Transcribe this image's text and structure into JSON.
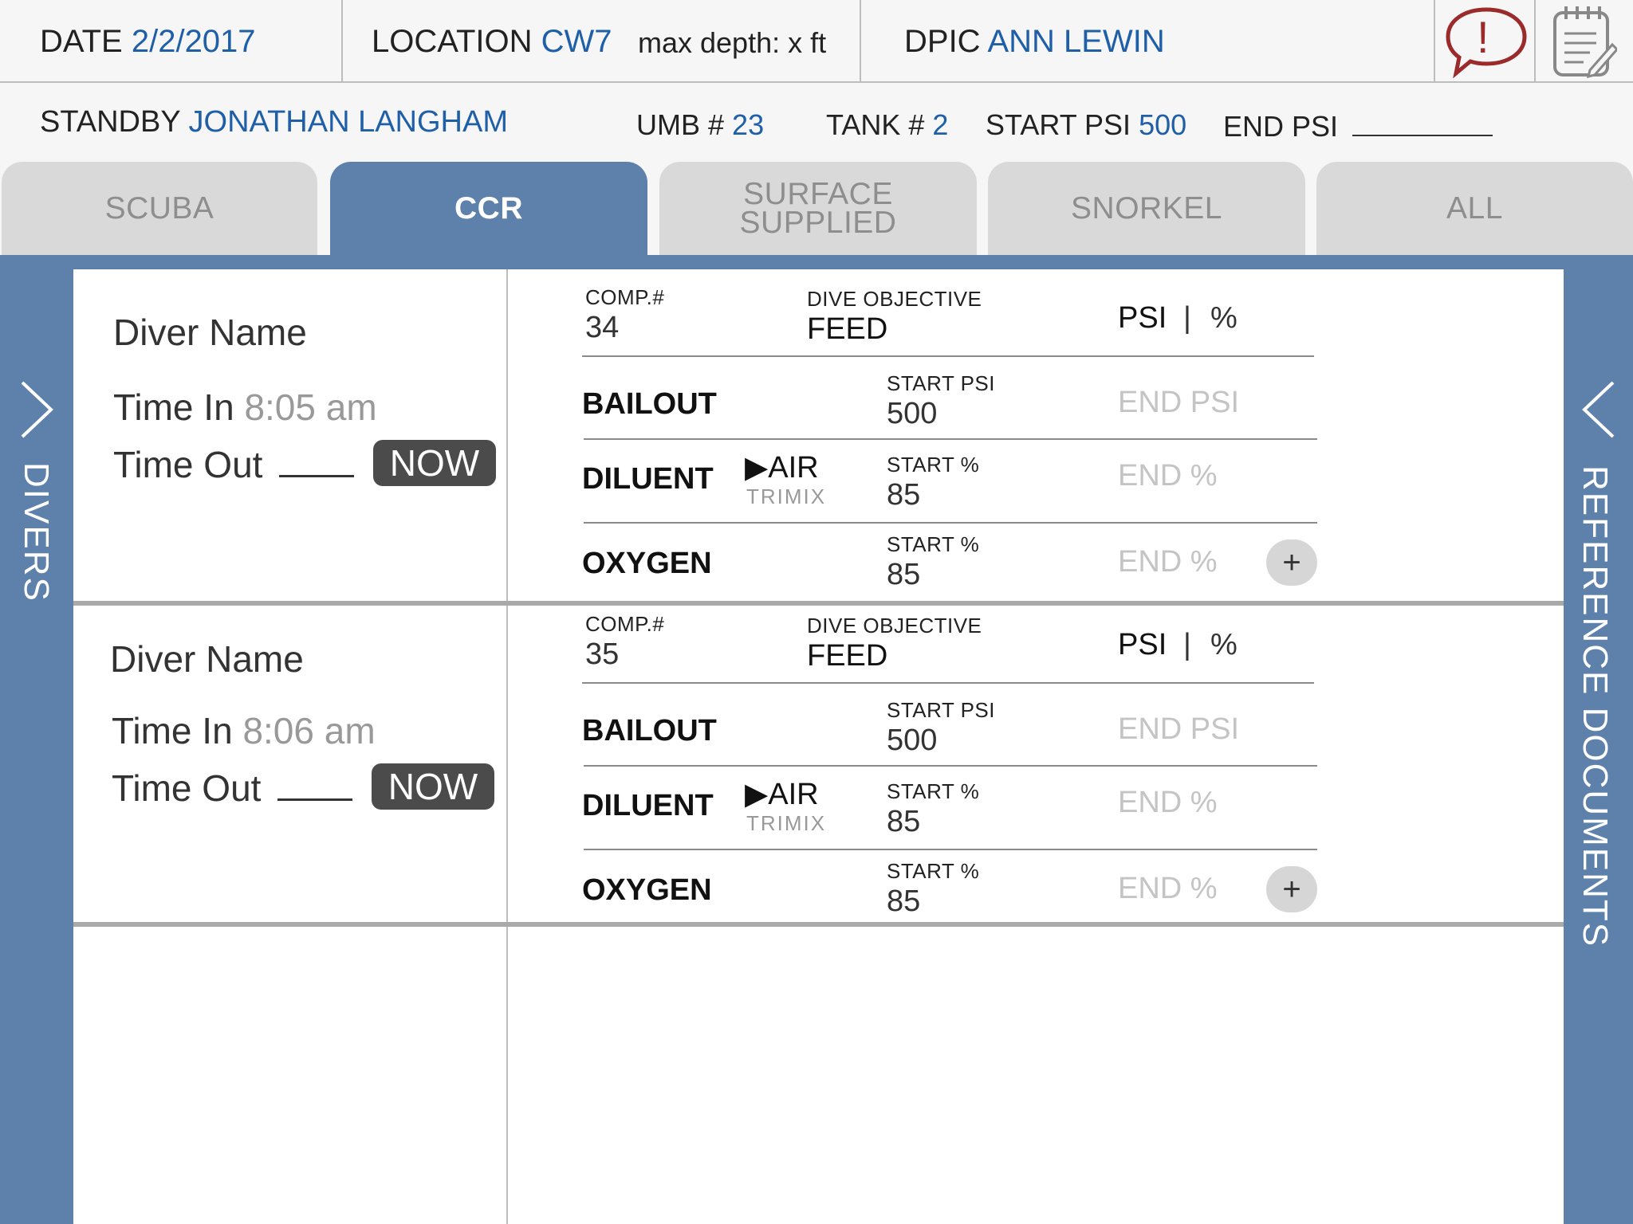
{
  "header": {
    "date_label": "DATE",
    "date_value": "2/2/2017",
    "location_label": "LOCATION",
    "location_value": "CW7",
    "max_depth": "max depth: x ft",
    "dpic_label": "DPIC",
    "dpic_value": "ANN LEWIN",
    "alert_glyph": "!",
    "icons": [
      "alert-speech-bubble-icon",
      "notepad-icon"
    ]
  },
  "subheader": {
    "standby_label": "STANDBY",
    "standby_value": "JONATHAN LANGHAM",
    "umb_label": "UMB #",
    "umb_value": "23",
    "tank_label": "TANK #",
    "tank_value": "2",
    "start_psi_label": "START PSI",
    "start_psi_value": "500",
    "end_psi_label": "END PSI"
  },
  "tabs": [
    {
      "label": "SCUBA",
      "active": false
    },
    {
      "label": "CCR",
      "active": true
    },
    {
      "label": "SURFACE SUPPLIED",
      "line1": "SURFACE",
      "line2": "SUPPLIED",
      "active": false
    },
    {
      "label": "SNORKEL",
      "active": false
    },
    {
      "label": "ALL",
      "active": false
    }
  ],
  "rails": {
    "left_label": "DIVERS",
    "right_label": "REFERENCE DOCUMENTS",
    "left_arrow": "chevron-right-icon",
    "right_arrow": "chevron-left-icon"
  },
  "divers": [
    {
      "name": "Diver Name",
      "time_in_label": "Time In",
      "time_in_value": "8:05 am",
      "time_out_label": "Time Out",
      "now_label": "NOW",
      "comp_label": "COMP.#",
      "comp_value": "34",
      "objective_label": "DIVE OBJECTIVE",
      "objective_value": "FEED",
      "unit_psi": "PSI",
      "unit_sep": "|",
      "unit_pct": "%",
      "bailout_label": "BAILOUT",
      "bailout_start_label": "START PSI",
      "bailout_start_value": "500",
      "bailout_end_placeholder": "END PSI",
      "diluent_label": "DILUENT",
      "diluent_selected": "▶AIR",
      "diluent_alt": "TRIMIX",
      "diluent_start_label": "START %",
      "diluent_start_value": "85",
      "diluent_end_placeholder": "END %",
      "oxygen_label": "OXYGEN",
      "oxygen_start_label": "START %",
      "oxygen_start_value": "85",
      "oxygen_end_placeholder": "END %",
      "add_label": "+"
    },
    {
      "name": "Diver Name",
      "time_in_label": "Time In",
      "time_in_value": "8:06 am",
      "time_out_label": "Time Out",
      "now_label": "NOW",
      "comp_label": "COMP.#",
      "comp_value": "35",
      "objective_label": "DIVE OBJECTIVE",
      "objective_value": "FEED",
      "unit_psi": "PSI",
      "unit_sep": "|",
      "unit_pct": "%",
      "bailout_label": "BAILOUT",
      "bailout_start_label": "START PSI",
      "bailout_start_value": "500",
      "bailout_end_placeholder": "END PSI",
      "diluent_label": "DILUENT",
      "diluent_selected": "▶AIR",
      "diluent_alt": "TRIMIX",
      "diluent_start_label": "START %",
      "diluent_start_value": "85",
      "diluent_end_placeholder": "END %",
      "oxygen_label": "OXYGEN",
      "oxygen_start_label": "START %",
      "oxygen_start_value": "85",
      "oxygen_end_placeholder": "END %",
      "add_label": "+"
    }
  ]
}
